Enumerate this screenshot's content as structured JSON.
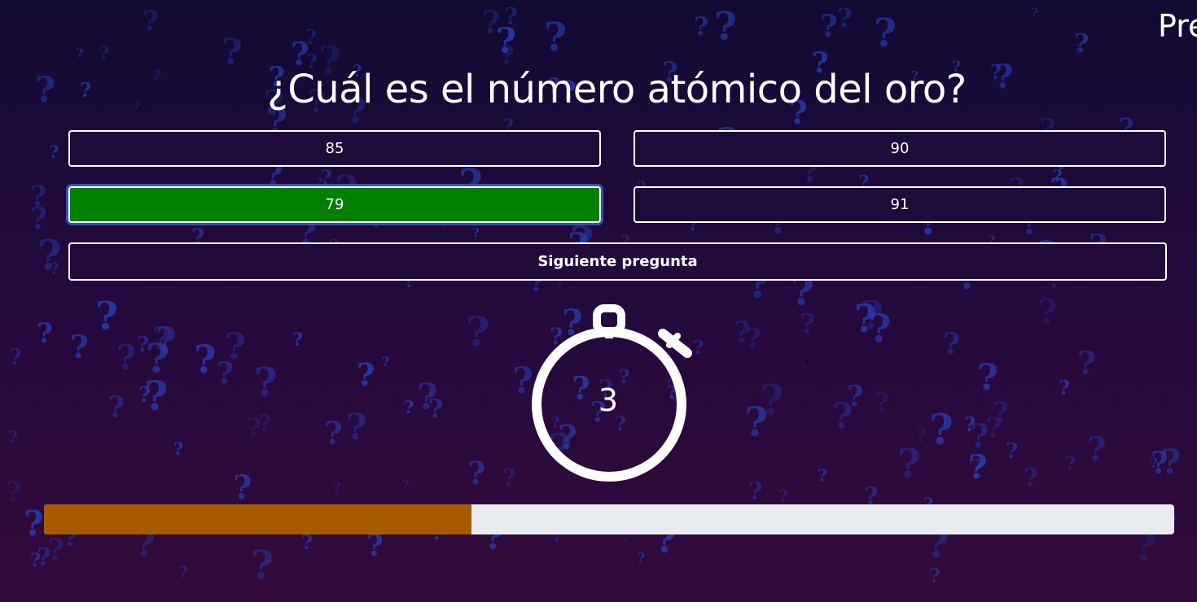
{
  "header": {
    "label": "Pre"
  },
  "question": {
    "text": "¿Cuál es el número atómico del oro?"
  },
  "answers": [
    {
      "label": "85",
      "state": "default"
    },
    {
      "label": "90",
      "state": "default"
    },
    {
      "label": "79",
      "state": "correct"
    },
    {
      "label": "91",
      "state": "default"
    }
  ],
  "next_button": {
    "label": "Siguiente pregunta"
  },
  "timer": {
    "value": "3",
    "icon": "stopwatch-icon"
  },
  "progress": {
    "fraction": 0.378
  },
  "colors": {
    "correct": "#008000",
    "progress_fill": "#a85a00",
    "progress_track": "#e9ecef",
    "background_top": "#120a33",
    "background_bottom": "#320a3b",
    "background_symbol": "#2a3fb8"
  },
  "background": {
    "symbol": "?"
  }
}
